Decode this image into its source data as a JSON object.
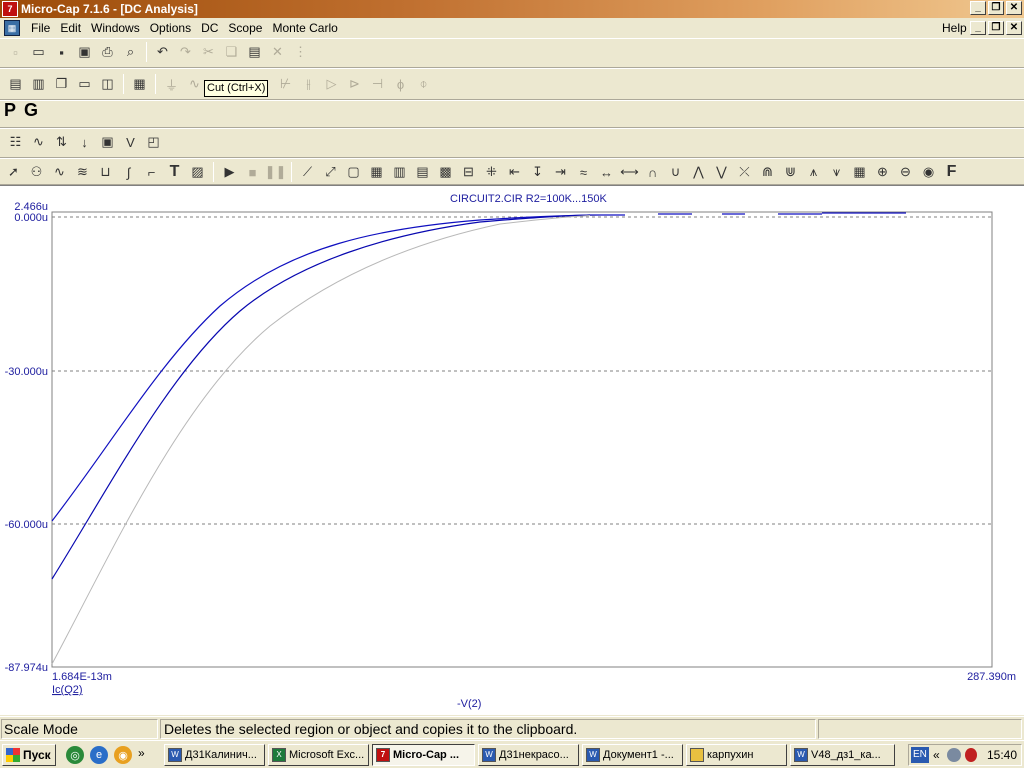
{
  "window": {
    "title": "Micro-Cap 7.1.6 - [DC Analysis]",
    "app_icon": "7"
  },
  "menu": {
    "items": [
      "File",
      "Edit",
      "Windows",
      "Options",
      "DC",
      "Scope",
      "Monte Carlo"
    ],
    "help": "Help"
  },
  "tooltip": "Cut (Ctrl+X)",
  "pg": {
    "p": "P",
    "g": "G"
  },
  "plot": {
    "title": "CIRCUIT2.CIR R2=100K...150K",
    "y_top": "2.466u",
    "y_zero": "0.000u",
    "y_m30": "-30.000u",
    "y_m60": "-60.000u",
    "y_bottom": "-87.974u",
    "x_left": "1.684E-13m",
    "x_right": "287.390m",
    "y_var": "Ic(Q2)",
    "x_var": "-V(2)",
    "colors": {
      "series_a": "#1010c0",
      "series_b": "#0808b0",
      "series_c": "#b8b8b8",
      "grid": "#808080",
      "label": "#2020a0"
    }
  },
  "status": {
    "mode": "Scale Mode",
    "message": "Deletes the selected region or object and copies it to the clipboard."
  },
  "taskbar": {
    "start": "Пуск",
    "quick_more": "»",
    "buttons": [
      "Д31Калинич...",
      "Microsoft Exc...",
      "Micro-Cap ...",
      "Д31некрасо...",
      "Документ1 -...",
      "карпухин",
      "V48_дз1_ка..."
    ],
    "lang": "EN",
    "tray_more": "«",
    "time": "15:40"
  }
}
